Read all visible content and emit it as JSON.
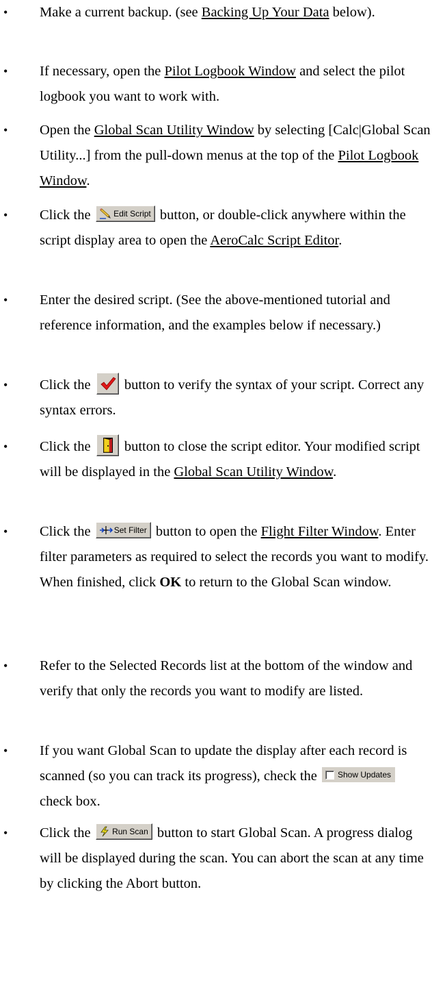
{
  "steps": {
    "s1": {
      "a": "Make a current backup. (see ",
      "link": "Backing Up Your Data",
      "b": " below)."
    },
    "s2": {
      "a": "If necessary, open the ",
      "link": "Pilot Logbook Window",
      "b": " and select the pilot logbook you want to work with."
    },
    "s3": {
      "a": "Open the ",
      "link1": "Global Scan Utility Window",
      "b": " by selecting [Calc|Global Scan Utility...] from the pull-down menus at the top of the ",
      "link2": "Pilot Logbook Window",
      "c": "."
    },
    "s4": {
      "a": "Click the ",
      "button": "Edit Script",
      "b": " button, or double-click anywhere within the script display area to open the ",
      "link": "AeroCalc Script Editor",
      "c": "."
    },
    "s5": {
      "text": "Enter the desired script. (See the above-mentioned tutorial and reference information, and the examples below if necessary.)"
    },
    "s6": {
      "a": "Click the ",
      "b": " button to verify the syntax of your script. Correct any syntax errors."
    },
    "s7": {
      "a": "Click the ",
      "b": " button to close the script editor.  Your modified script will be displayed in the ",
      "link": "Global Scan Utility Window",
      "c": "."
    },
    "s8": {
      "a": "Click the ",
      "button": "Set Filter",
      "b": " button to open the ",
      "link": "Flight Filter Window",
      "c": ". Enter filter parameters as required to select the records you want to modify.   When finished, click ",
      "bold": "OK",
      "d": " to return to the Global Scan window."
    },
    "s9": {
      "text": "Refer to the Selected Records list at the bottom of the window and verify that only the records you want to modify are listed."
    },
    "s10": {
      "a": "If you want Global Scan to update the display after each record is scanned (so you can track its progress), check the ",
      "checkbox": "Show Updates",
      "b": " check box."
    },
    "s11": {
      "a": "Click the ",
      "button": "Run Scan",
      "b": " button to start Global Scan.  A progress dialog will be displayed during the scan. You can abort the scan at any time by clicking the Abort button."
    }
  },
  "bullet": "•",
  "icons": {
    "edit": "pencil-icon",
    "verify": "checkmark-icon",
    "close": "exit-door-icon",
    "filter": "filter-arrows-icon",
    "run": "lightning-icon"
  }
}
